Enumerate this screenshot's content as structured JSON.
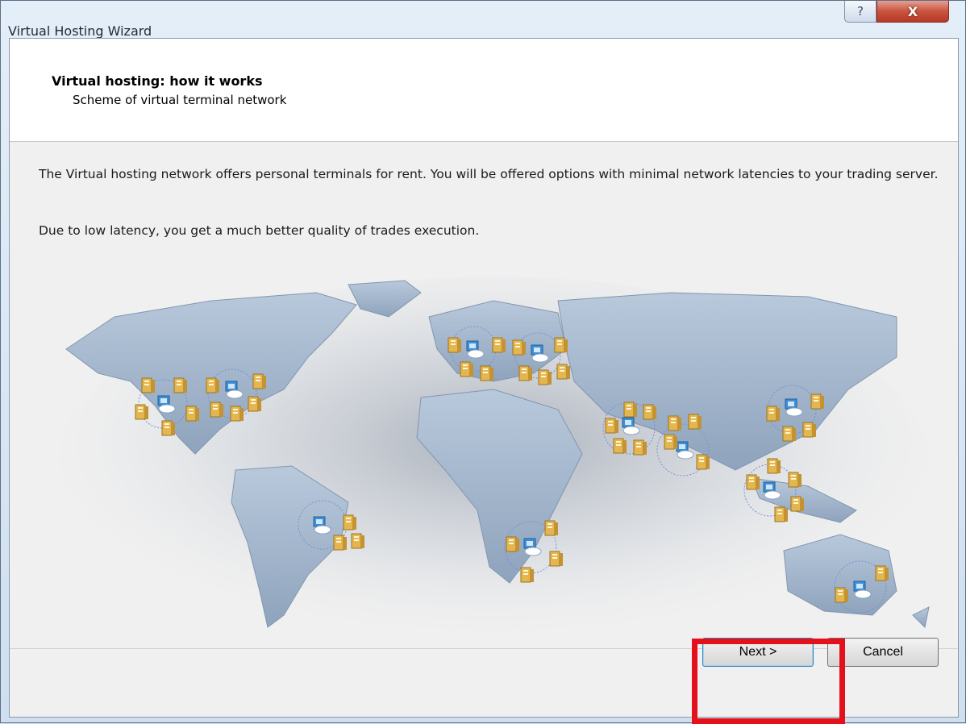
{
  "window": {
    "title": "Virtual Hosting Wizard",
    "help_label": "?",
    "close_label": "X"
  },
  "header": {
    "title": "Virtual hosting: how it works",
    "subtitle": "Scheme of virtual terminal network"
  },
  "content": {
    "paragraph1": "The Virtual hosting network offers personal terminals for rent. You will be offered options with minimal network latencies to your trading server.",
    "paragraph2": "Due to low latency, you get a much better quality of trades execution."
  },
  "buttons": {
    "next_label": "Next >",
    "cancel_label": "Cancel"
  },
  "colors": {
    "highlight": "#e4101c",
    "server": "#e2b24a",
    "terminal": "#3f8fd6"
  }
}
